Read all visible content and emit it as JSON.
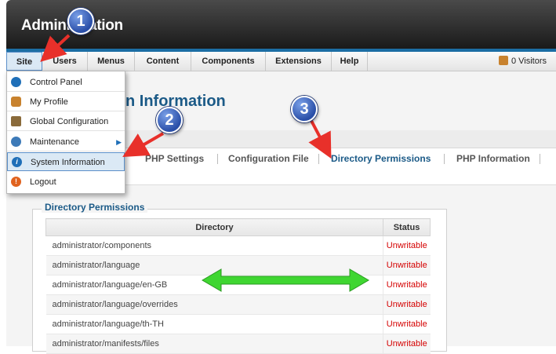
{
  "header": {
    "title": "Administration"
  },
  "menubar": {
    "items": [
      "Site",
      "Users",
      "Menus",
      "Content",
      "Components",
      "Extensions",
      "Help"
    ],
    "visitors": "0 Visitors"
  },
  "page": {
    "title": "System Information",
    "title_visible": "n Information"
  },
  "tabs": [
    "PHP Settings",
    "Configuration File",
    "Directory Permissions",
    "PHP Information"
  ],
  "site_menu": {
    "items": [
      "Control Panel",
      "My Profile",
      "Global Configuration",
      "Maintenance",
      "System Information",
      "Logout"
    ],
    "selected": "System Information"
  },
  "dir_permissions": {
    "legend": "Directory Permissions",
    "columns": [
      "Directory",
      "Status"
    ],
    "rows": [
      {
        "dir": "administrator/components",
        "status": "Unwritable"
      },
      {
        "dir": "administrator/language",
        "status": "Unwritable"
      },
      {
        "dir": "administrator/language/en-GB",
        "status": "Unwritable"
      },
      {
        "dir": "administrator/language/overrides",
        "status": "Unwritable"
      },
      {
        "dir": "administrator/language/th-TH",
        "status": "Unwritable"
      },
      {
        "dir": "administrator/manifests/files",
        "status": "Unwritable"
      }
    ]
  },
  "callouts": [
    "1",
    "2",
    "3"
  ],
  "colors": {
    "accent": "#1b5a87",
    "status_unwritable": "#d40000",
    "arrow_red": "#e8302a",
    "arrow_green": "#3fd631",
    "badge_blue": "#2a4fa8"
  }
}
